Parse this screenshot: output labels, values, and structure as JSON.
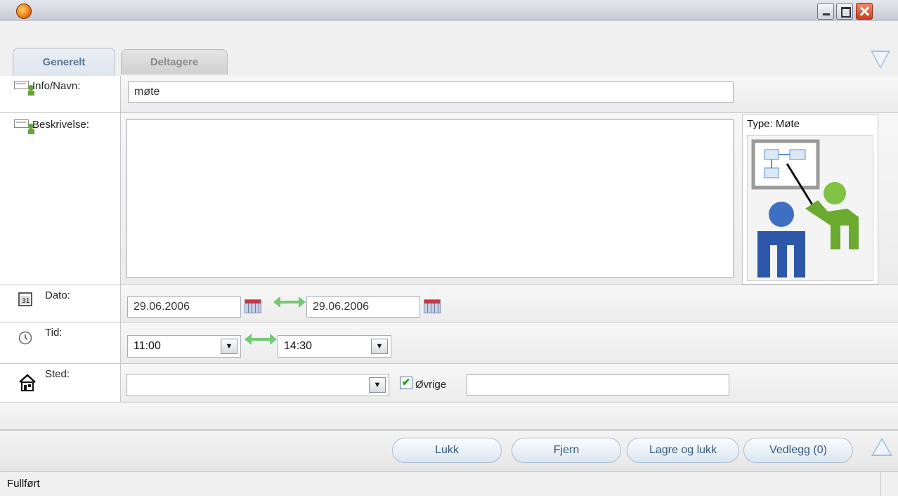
{
  "window": {
    "title": ""
  },
  "tabs": [
    {
      "label": "Generelt",
      "active": true
    },
    {
      "label": "Deltagere",
      "active": false
    }
  ],
  "fields": {
    "info": {
      "label": "Info/Navn:",
      "value": "møte"
    },
    "description": {
      "label": "Beskrivelse:",
      "value": ""
    },
    "date": {
      "label": "Dato:",
      "start": "29.06.2006",
      "end": "29.06.2006"
    },
    "time": {
      "label": "Tid:",
      "start": "11:00",
      "end": "14:30"
    },
    "place": {
      "label": "Sted:",
      "value": "",
      "other_label": "Øvrige",
      "other_checked": true,
      "other_value": ""
    }
  },
  "type_panel": {
    "label": "Type: Møte"
  },
  "buttons": {
    "close": "Lukk",
    "remove": "Fjern",
    "save_close": "Lagre og lukk",
    "attachments": "Vedlegg (0)"
  },
  "status": {
    "text": "Fullført"
  },
  "colors": {
    "accent_blue": "#9fc3e0",
    "green_arrow": "#74c876",
    "tab_text": "#5a7a94"
  },
  "icons": [
    "app-icon",
    "minimize-icon",
    "maximize-icon",
    "close-icon",
    "collapse-down-icon",
    "expand-up-icon",
    "edit-person-icon",
    "calendar-icon",
    "clock-icon",
    "house-icon",
    "meeting-presentation-icon",
    "dropdown-arrow-icon",
    "two-way-arrow-icon"
  ]
}
